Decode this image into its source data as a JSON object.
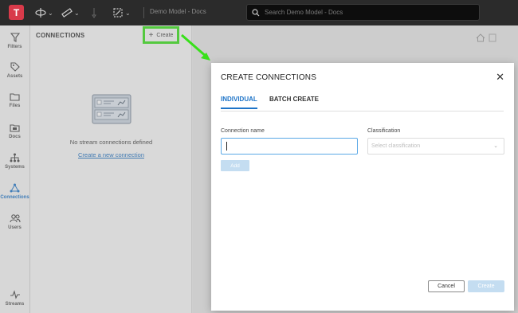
{
  "topbar": {
    "logo_letter": "T",
    "breadcrumb": "Demo Model - Docs",
    "search_placeholder": "Search Demo Model - Docs"
  },
  "sidebar": {
    "items": [
      {
        "label": "Filters",
        "icon": "filter-icon"
      },
      {
        "label": "Assets",
        "icon": "tag-icon"
      },
      {
        "label": "Files",
        "icon": "folder-icon"
      },
      {
        "label": "Docs",
        "icon": "docs-icon"
      },
      {
        "label": "Systems",
        "icon": "hierarchy-icon"
      },
      {
        "label": "Connections",
        "icon": "connections-icon",
        "active": true
      },
      {
        "label": "Users",
        "icon": "users-icon"
      },
      {
        "label": "Streams",
        "icon": "pulse-icon"
      }
    ],
    "active_color": "#1e74c8"
  },
  "panel": {
    "title": "CONNECTIONS",
    "create_label": "Create",
    "empty_text": "No stream connections defined",
    "empty_link": "Create a new connection",
    "highlight_color": "#38e01a"
  },
  "modal": {
    "title": "CREATE CONNECTIONS",
    "tabs": [
      {
        "label": "INDIVIDUAL",
        "active": true
      },
      {
        "label": "BATCH CREATE",
        "active": false
      }
    ],
    "connection_name_label": "Connection name",
    "connection_name_value": "",
    "classification_label": "Classification",
    "classification_placeholder": "Select classification",
    "add_label": "Add",
    "cancel_label": "Cancel",
    "create_label": "Create"
  }
}
